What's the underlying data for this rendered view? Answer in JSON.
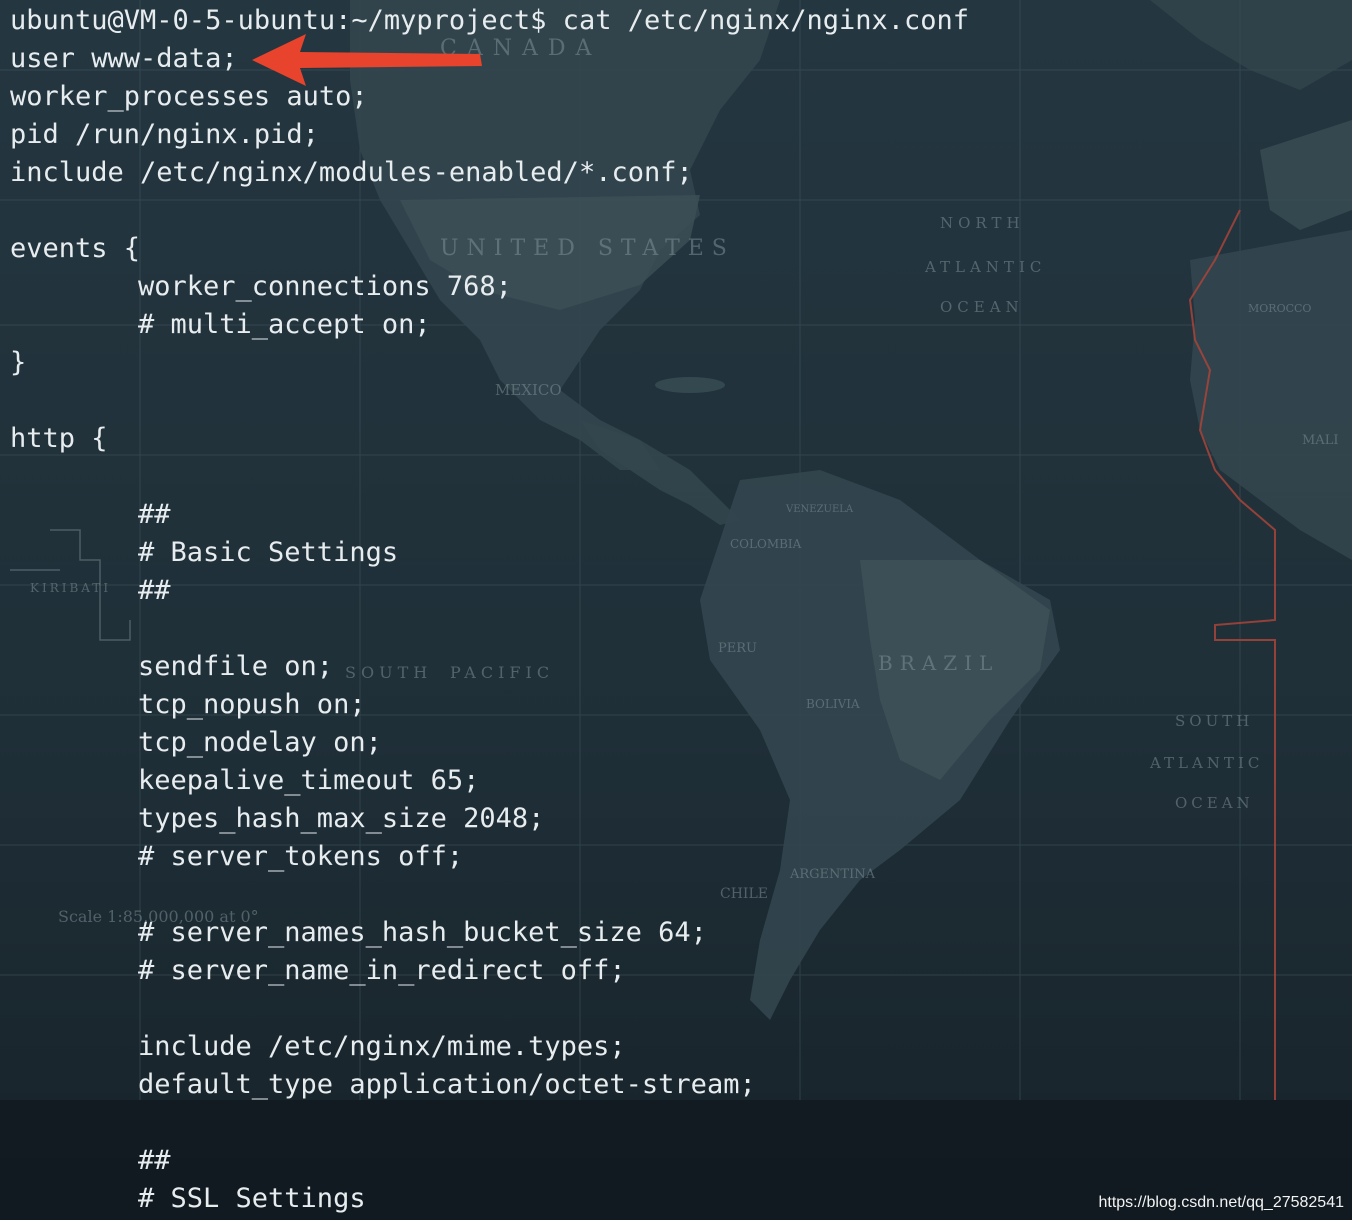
{
  "terminal": {
    "lines": [
      {
        "text": "ubuntu@VM-0-5-ubuntu:~/myproject$ cat /etc/nginx/nginx.conf",
        "indent": false
      },
      {
        "text": "user www-data;",
        "indent": false
      },
      {
        "text": "worker_processes auto;",
        "indent": false
      },
      {
        "text": "pid /run/nginx.pid;",
        "indent": false
      },
      {
        "text": "include /etc/nginx/modules-enabled/*.conf;",
        "indent": false
      },
      {
        "text": "",
        "indent": false
      },
      {
        "text": "events {",
        "indent": false
      },
      {
        "text": "worker_connections 768;",
        "indent": true
      },
      {
        "text": "# multi_accept on;",
        "indent": true
      },
      {
        "text": "}",
        "indent": false
      },
      {
        "text": "",
        "indent": false
      },
      {
        "text": "http {",
        "indent": false
      },
      {
        "text": "",
        "indent": false
      },
      {
        "text": "##",
        "indent": true
      },
      {
        "text": "# Basic Settings",
        "indent": true
      },
      {
        "text": "##",
        "indent": true
      },
      {
        "text": "",
        "indent": false
      },
      {
        "text": "sendfile on;",
        "indent": true
      },
      {
        "text": "tcp_nopush on;",
        "indent": true
      },
      {
        "text": "tcp_nodelay on;",
        "indent": true
      },
      {
        "text": "keepalive_timeout 65;",
        "indent": true
      },
      {
        "text": "types_hash_max_size 2048;",
        "indent": true
      },
      {
        "text": "# server_tokens off;",
        "indent": true
      },
      {
        "text": "",
        "indent": false
      },
      {
        "text": "# server_names_hash_bucket_size 64;",
        "indent": true
      },
      {
        "text": "# server_name_in_redirect off;",
        "indent": true
      },
      {
        "text": "",
        "indent": false
      },
      {
        "text": "include /etc/nginx/mime.types;",
        "indent": true
      },
      {
        "text": "default_type application/octet-stream;",
        "indent": true
      },
      {
        "text": "",
        "indent": false
      },
      {
        "text": "##",
        "indent": true
      },
      {
        "text": "# SSL Settings",
        "indent": true
      }
    ]
  },
  "map_labels": [
    "CANADA",
    "UNITED STATES",
    "NORTH",
    "ATLANTIC",
    "OCEAN",
    "MEXICO",
    "COLOMBIA",
    "PERU",
    "BRAZIL",
    "BOLIVIA",
    "CHILE",
    "ARGENTINA",
    "SOUTH",
    "PACIFIC",
    "KIRIBATI",
    "SOUTH",
    "ATLANTIC",
    "OCEAN",
    "Scale 1:85,000,000 at 0°",
    "MALI",
    "MOROCCO",
    "VENEZUELA"
  ],
  "annotation": {
    "arrow_color": "#e8432c",
    "icon": "arrow-left-icon"
  },
  "watermark": {
    "text": "https://blog.csdn.net/qq_27582541"
  },
  "colors": {
    "background": "#1f2f38",
    "text": "#e7ecef",
    "land": "#33464f",
    "grid": "#4a5d66",
    "border_red": "#a8443a"
  }
}
